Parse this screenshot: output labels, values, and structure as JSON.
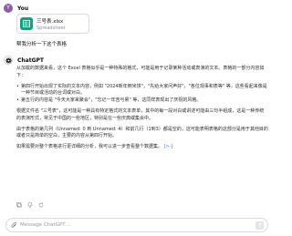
{
  "user": {
    "name": "You",
    "avatar_initial": "Y",
    "avatar_color": "#8e5ba8"
  },
  "file": {
    "name": "三号表.xlsx",
    "type": "Spreadsheet",
    "icon": "spreadsheet-icon",
    "icon_color": "#10a37f"
  },
  "user_message": "帮我分析一下这个表格",
  "assistant": {
    "name": "ChatGPT",
    "icon": "chatgpt-logo-icon"
  },
  "answer": {
    "intro": "从加载的数据来看，这个 Excel 表格似乎是一种特殊的格式，可能是用于记录某种活动或表演的文本。表格的一部分内容如下：",
    "bullets": [
      "第四行开始出现了实际的文本内容，例如 \"2024新年倒米饼\"，\"先给大家问声好\"，\"各位观事和表等\" 等，这些看起来像是一种节目或活动的台词或对白。",
      "第五行的内容是 \"今天大家来聚会\"，\"忘记一年苦与累\" 等，这同样表现出了庆祝的风格。"
    ],
    "para2": "根据文件名 \"三号表\"，这可能是一种具有特定格式的文本表单，其中的每一段对白或讲述可能由三句半组成，这是一种传统的表演形式，常见于中国的一些地区，特别是在一些庆典或集会中。",
    "para3": "由于表格的第几列（Unnamed: 0 到 Unnamed: 4）和前几行（1到3）都是空的，这可能表明表格的这部分是用于其他目的或者只是简单的空白，主要的内容从第四行开始。",
    "para4": "如果需要对整个表格进行更详细的分析，我可以进一步查看整个数据集。",
    "citation": "[>-]"
  },
  "actions": [
    "copy-icon",
    "thumbs-down-icon",
    "regenerate-icon"
  ],
  "composer": {
    "placeholder": "Message ChatGPT…",
    "value": ""
  },
  "colors": {
    "accent": "#10a37f",
    "link": "#5b7bd5",
    "muted": "#8e8ea0"
  }
}
